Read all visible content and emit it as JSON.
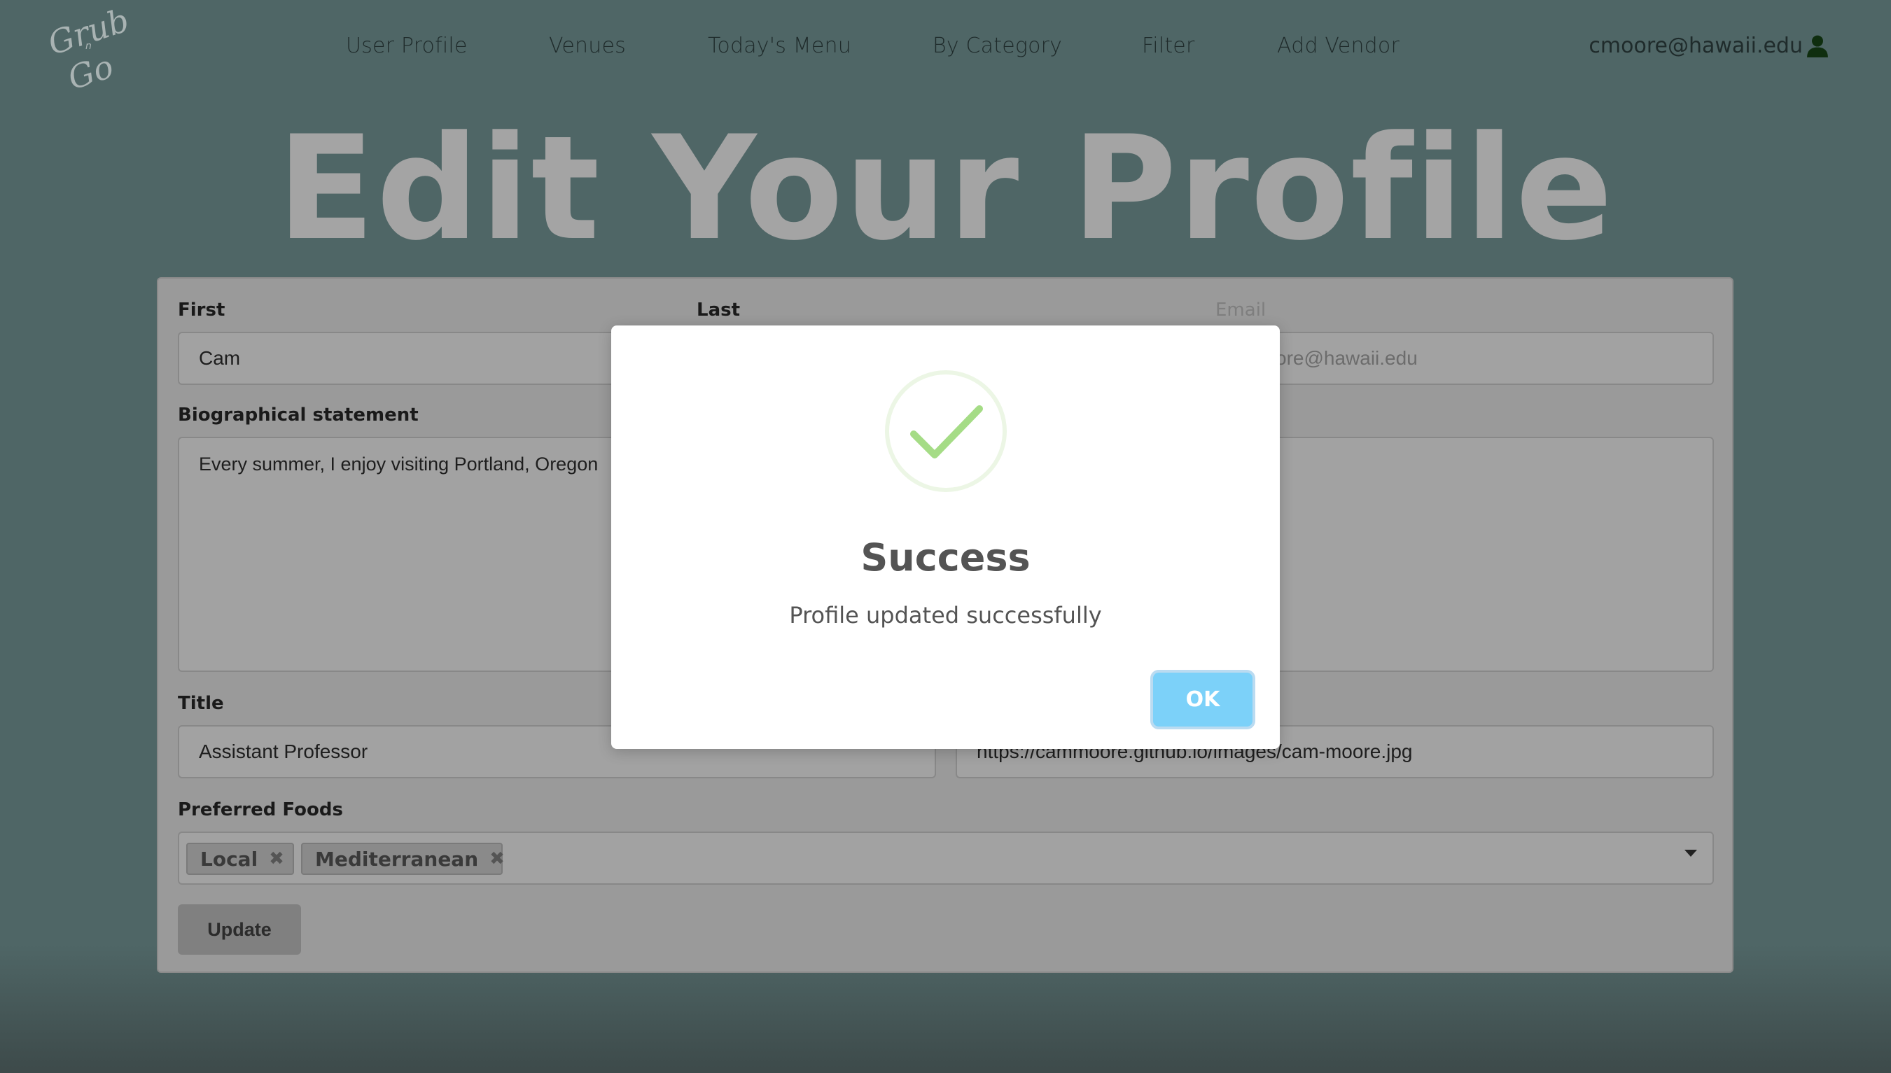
{
  "colors": {
    "background": "#4f6666",
    "card": "#9a9a9a",
    "title": "#a4a4a4",
    "ok_button": "#7cd1f9",
    "success_check": "#a5dc86"
  },
  "logo": {
    "text": "Grub n Go",
    "icon": "grub-n-go-logo"
  },
  "nav": {
    "items": [
      {
        "label": "User Profile"
      },
      {
        "label": "Venues"
      },
      {
        "label": "Today's Menu"
      },
      {
        "label": "By Category"
      },
      {
        "label": "Filter"
      },
      {
        "label": "Add Vendor"
      }
    ],
    "user_email": "cmoore@hawaii.edu",
    "user_icon": "user-icon"
  },
  "page_title": "Edit Your Profile",
  "form": {
    "first": {
      "label": "First",
      "value": "Cam"
    },
    "last": {
      "label": "Last",
      "value": ""
    },
    "email": {
      "label": "Email",
      "value": "cmoore@hawaii.edu",
      "visible_value": "ore@hawaii.edu"
    },
    "bio": {
      "label": "Biographical statement",
      "value": "Every summer, I enjoy visiting Portland, Oregon"
    },
    "title": {
      "label": "Title",
      "value": "Assistant Professor"
    },
    "picture": {
      "value": "https://cammoore.github.io/images/cam-moore.jpg"
    },
    "preferred_foods": {
      "label": "Preferred Foods",
      "selected": [
        "Local",
        "Mediterranean"
      ],
      "remove_glyph": "✖"
    },
    "update_label": "Update"
  },
  "modal": {
    "icon": "success-check-icon",
    "title": "Success",
    "message": "Profile updated successfully",
    "ok_label": "OK"
  }
}
